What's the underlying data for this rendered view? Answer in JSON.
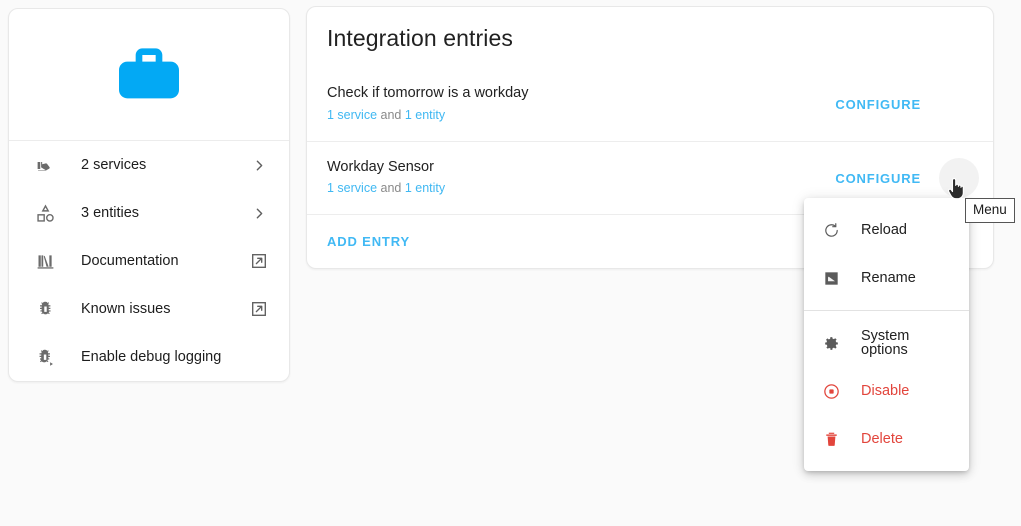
{
  "theme": {
    "brand_blue": "#03A9F4",
    "link_blue": "#40B8F2",
    "danger_red": "#E2453C",
    "page_background": "#FAFAFA",
    "card_background": "#FFFFFF",
    "text_primary": "#212121",
    "text_muted": "#8A8A8A"
  },
  "sidebar": {
    "logo_icon": "briefcase-icon",
    "items": [
      {
        "label": "2 services",
        "icon": "gesture-hand-icon",
        "trailing_icon": "chevron-right-icon"
      },
      {
        "label": "3 entities",
        "icon": "shapes-icon",
        "trailing_icon": "chevron-right-icon"
      },
      {
        "label": "Documentation",
        "icon": "bookshelf-icon",
        "trailing_icon": "open-in-new-icon"
      },
      {
        "label": "Known issues",
        "icon": "bug-icon",
        "trailing_icon": "open-in-new-icon"
      },
      {
        "label": "Enable debug logging",
        "icon": "bug-play-icon",
        "trailing_icon": ""
      }
    ]
  },
  "main": {
    "title": "Integration entries",
    "entries": [
      {
        "title": "Check if tomorrow is a workday",
        "service_link": "1 service",
        "conjunction": " and ",
        "entity_link": "1 entity",
        "configure_label": "CONFIGURE",
        "menu_icon": "dots-vertical-icon"
      },
      {
        "title": "Workday Sensor",
        "service_link": "1 service",
        "conjunction": " and ",
        "entity_link": "1 entity",
        "configure_label": "CONFIGURE",
        "menu_icon": "dots-vertical-icon"
      }
    ],
    "add_entry_label": "ADD ENTRY"
  },
  "menu": {
    "items": [
      {
        "label": "Reload",
        "icon": "refresh-icon",
        "danger": false
      },
      {
        "label": "Rename",
        "icon": "rename-box-icon",
        "danger": false
      },
      {
        "label": "System options",
        "icon": "gear-icon",
        "danger": false
      },
      {
        "label": "Disable",
        "icon": "stop-circle-icon",
        "danger": true
      },
      {
        "label": "Delete",
        "icon": "trash-icon",
        "danger": true
      }
    ]
  },
  "tooltip": {
    "text": "Menu"
  }
}
